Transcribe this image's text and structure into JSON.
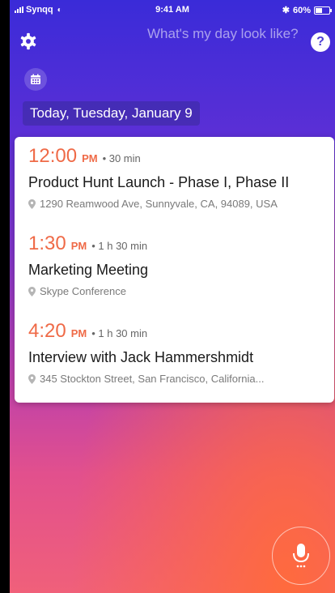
{
  "status_bar": {
    "carrier": "Synqq",
    "time": "9:41 AM",
    "battery": "60%",
    "battery_level": 0.6
  },
  "header": {
    "query": "What's my day look like?",
    "help_label": "?"
  },
  "date_label": "Today, Tuesday, January 9",
  "events": [
    {
      "time": "12:00",
      "ampm": "PM",
      "duration": "• 30 min",
      "title": "Product Hunt Launch - Phase I, Phase II",
      "location": "1290 Reamwood Ave, Sunnyvale, CA, 94089, USA"
    },
    {
      "time": "1:30",
      "ampm": "PM",
      "duration": "• 1 h 30 min",
      "title": "Marketing Meeting",
      "location": "Skype Conference"
    },
    {
      "time": "4:20",
      "ampm": "PM",
      "duration": "• 1 h 30 min",
      "title": "Interview with Jack Hammershmidt",
      "location": "345 Stockton Street, San Francisco, California..."
    }
  ],
  "colors": {
    "accent": "#ef6a47",
    "gradient_top": "#3a2bd8",
    "gradient_bottom": "#f0607a"
  },
  "icons": [
    "gear-icon",
    "help-icon",
    "calendar-icon",
    "location-pin-icon",
    "microphone-icon"
  ]
}
